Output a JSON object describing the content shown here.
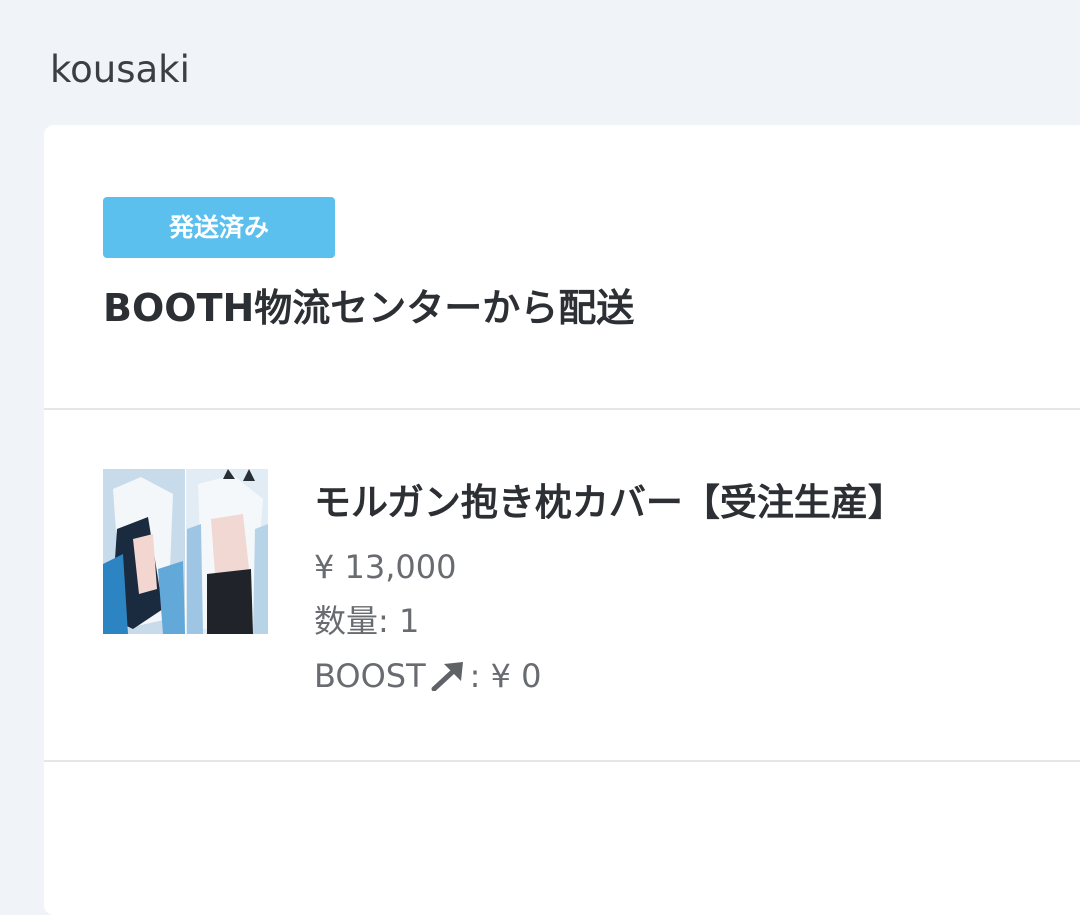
{
  "header": {
    "shop_name": "kousaki"
  },
  "order": {
    "status_badge": "発送済み",
    "shipping_method": "BOOTH物流センターから配送",
    "item": {
      "name": "モルガン抱き枕カバー【受注生産】",
      "price": "¥ 13,000",
      "quantity_label": "数量:",
      "quantity": "1",
      "boost_label": "BOOST",
      "boost_value": ": ¥ 0"
    }
  },
  "colors": {
    "page_background": "#f0f3f7",
    "status_badge": "#5bc0ee",
    "card": "#ffffff"
  },
  "icons": {
    "boost": "arrow-up-right-icon"
  }
}
